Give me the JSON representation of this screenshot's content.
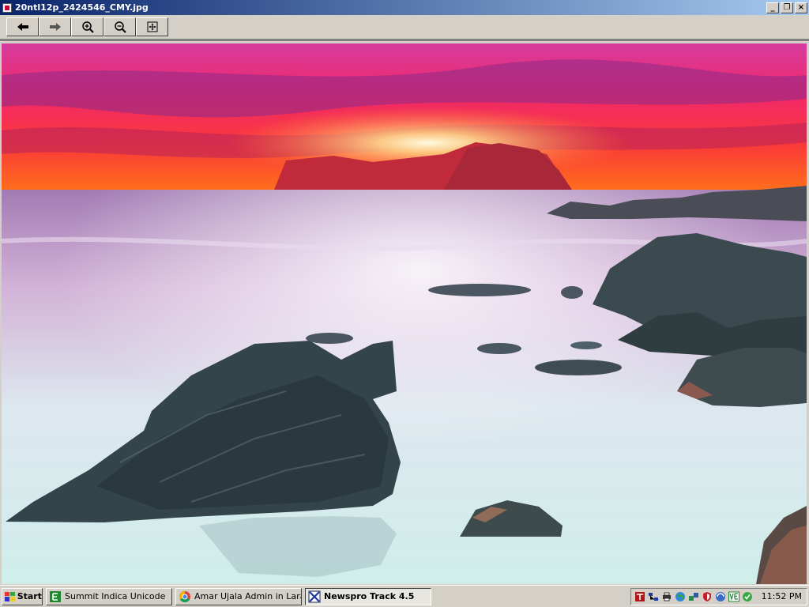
{
  "window": {
    "title": "20ntl12p_2424546_CMY.jpg",
    "controls": {
      "minimize": "_",
      "maximize": "❐",
      "close": "×"
    }
  },
  "toolbar": {
    "buttons": [
      "back-arrow-icon",
      "forward-arrow-icon",
      "zoom-in-icon",
      "zoom-out-icon",
      "fit-to-window-icon"
    ]
  },
  "image": {
    "subject": "sunset-seascape-photo",
    "colors": {
      "sky_top": "#d43aa0",
      "sky_mid": "#f0304a",
      "horizon": "#ff6a1a",
      "sun": "#fff6c8",
      "sea": "#c9a9cf",
      "shore": "#cfe9e6",
      "rock": "#3c4a4e"
    }
  },
  "taskbar": {
    "start_label": "Start",
    "tasks": [
      {
        "label": "Summit Indica Unicode",
        "icon": "green-e-icon",
        "active": false
      },
      {
        "label": "Amar Ujala Admin in Lara...",
        "icon": "chrome-icon",
        "active": false
      },
      {
        "label": "Newspro Track 4.5",
        "icon": "newspro-icon",
        "active": true
      }
    ],
    "tray_icons": [
      "red-app-icon",
      "network-icon",
      "printer-icon",
      "globe-icon",
      "network-alt-icon",
      "shield-icon",
      "monitor-icon",
      "ve-icon",
      "green-circle-icon"
    ],
    "clock": "11:52 PM"
  }
}
